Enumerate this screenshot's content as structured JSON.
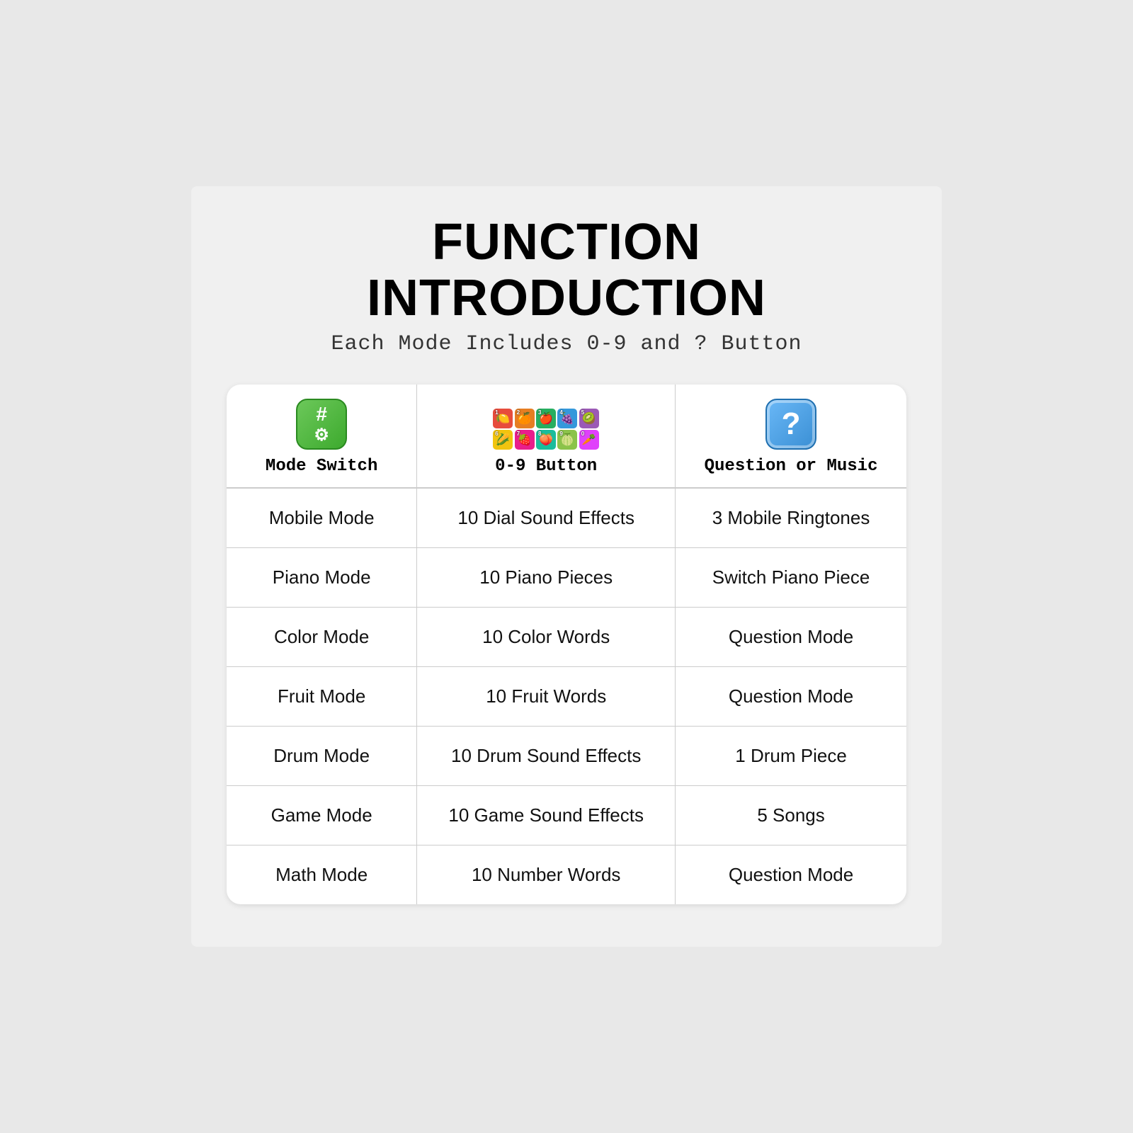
{
  "page": {
    "title": "FUNCTION INTRODUCTION",
    "subtitle": "Each Mode Includes 0-9 and ? Button"
  },
  "header": {
    "col1_label": "Mode Switch",
    "col2_label": "0-9 Button",
    "col3_label": "Question or Music"
  },
  "rows": [
    {
      "mode": "Mobile Mode",
      "button": "10 Dial Sound Effects",
      "question": "3 Mobile Ringtones"
    },
    {
      "mode": "Piano Mode",
      "button": "10 Piano Pieces",
      "question": "Switch Piano Piece"
    },
    {
      "mode": "Color Mode",
      "button": "10 Color Words",
      "question": "Question Mode"
    },
    {
      "mode": "Fruit Mode",
      "button": "10 Fruit Words",
      "question": "Question Mode"
    },
    {
      "mode": "Drum Mode",
      "button": "10 Drum Sound Effects",
      "question": "1 Drum Piece"
    },
    {
      "mode": "Game Mode",
      "button": "10 Game Sound Effects",
      "question": "5 Songs"
    },
    {
      "mode": "Math Mode",
      "button": "10 Number Words",
      "question": "Question Mode"
    }
  ],
  "grid_colors": [
    "gc-red",
    "gc-orange",
    "gc-green",
    "gc-blue",
    "gc-purple",
    "gc-yellow",
    "gc-pink",
    "gc-cyan",
    "gc-lime",
    "gc-magenta"
  ],
  "grid_numbers": [
    "1",
    "2",
    "3",
    "4",
    "5",
    "6",
    "7",
    "8",
    "9",
    "0"
  ],
  "icons": {
    "mode_switch_symbol": "⚙",
    "question_symbol": "?"
  }
}
